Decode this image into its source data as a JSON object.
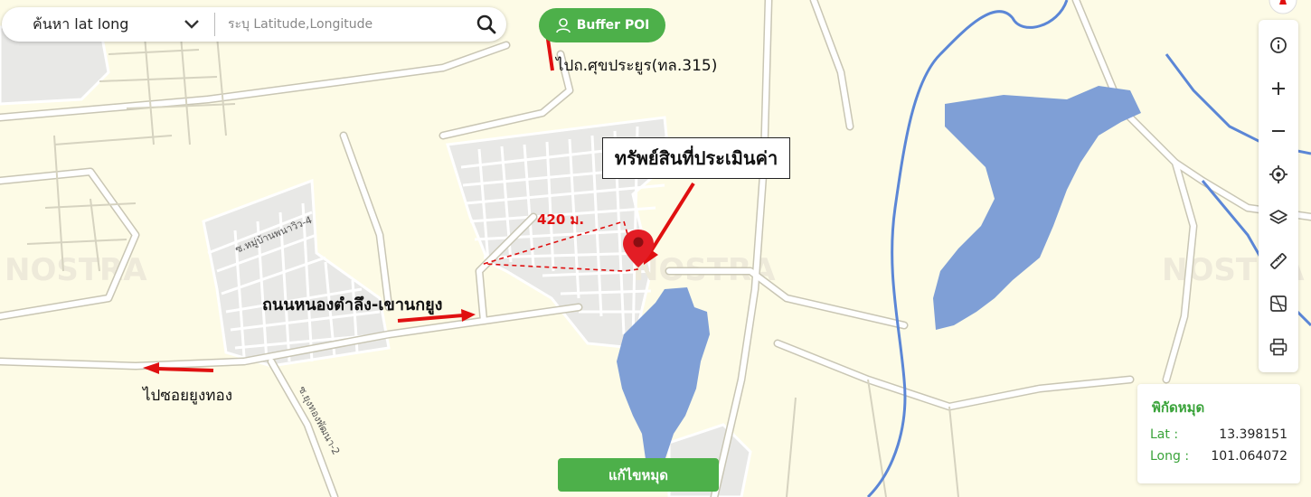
{
  "search": {
    "mode_label": "ค้นหา lat long",
    "placeholder": "ระบุ Latitude,Longitude"
  },
  "buffer_button": {
    "label": "Buffer POI"
  },
  "annotations": {
    "road_315": "ไปถ.ศุขประยูร(ทล.315)",
    "property": "ทรัพย์สินที่ประเมินค่า",
    "distance": "420 ม.",
    "main_road": "ถนนหนองตำลึง-เขานกยูง",
    "soi_yungthong": "ไปซอยยูงทอง"
  },
  "street_labels": {
    "soi_village": "ซ.หมู่บ้านพนาวิว-4",
    "soi_south": "ซ.ยุงทองพัฒนา-2"
  },
  "coordinates": {
    "title": "พิกัดหมุด",
    "lat_label": "Lat :",
    "lat_value": "13.398151",
    "long_label": "Long :",
    "long_value": "101.064072"
  },
  "edit_button": {
    "label": "แก้ไขหมุด"
  },
  "toolbar": [
    "info-icon",
    "zoom-in-icon",
    "zoom-out-icon",
    "locate-icon",
    "layers-icon",
    "ruler-icon",
    "map-card-icon",
    "print-icon"
  ],
  "colors": {
    "land": "#fdfbe6",
    "water": "#7f9fd6",
    "river": "#5b86d6",
    "block": "#e8e8e6",
    "road": "#ffffff",
    "road_edge": "#c9c6b4",
    "accent_green": "#4db04a",
    "annotation_red": "#e01010"
  }
}
